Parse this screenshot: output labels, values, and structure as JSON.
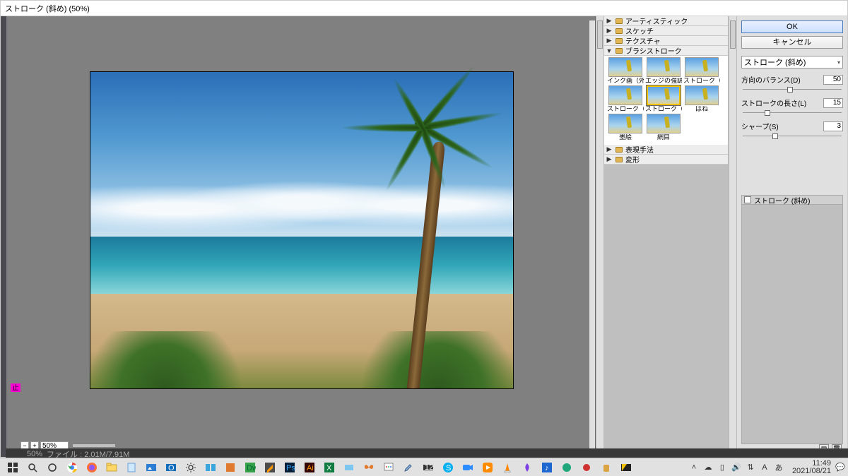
{
  "window": {
    "title": "ストローク (斜め) (50%)"
  },
  "canvas": {
    "zoom": "50%",
    "stop_indicator": "止"
  },
  "status": {
    "text": "ファイル : 2.01M/7.91M"
  },
  "filter_gallery": {
    "categories": {
      "artistic": "アーティスティック",
      "sketch": "スケッチ",
      "texture": "テクスチャ",
      "brush_strokes": "ブラシストローク",
      "stylize": "表現手法",
      "distort": "変形"
    },
    "brush_thumbs": [
      {
        "label": "インク画（外形）"
      },
      {
        "label": "エッジの強調"
      },
      {
        "label": "ストローク（スプレー）"
      },
      {
        "label": "ストローク（暗）"
      },
      {
        "label": "ストローク（斜め）"
      },
      {
        "label": "はね"
      },
      {
        "label": "墨絵"
      },
      {
        "label": "網目"
      }
    ],
    "selected_index": 4
  },
  "settings": {
    "ok": "OK",
    "cancel": "キャンセル",
    "filter_name": "ストローク (斜め)",
    "params": {
      "balance": {
        "label": "方向のバランス(D)",
        "value": "50",
        "pos": 45
      },
      "length": {
        "label": "ストロークの長さ(L)",
        "value": "15",
        "pos": 22
      },
      "sharp": {
        "label": "シャープ(S)",
        "value": "3",
        "pos": 30
      }
    }
  },
  "layers": {
    "applied": "ストローク (斜め)"
  },
  "taskbar": {
    "time": "11:49",
    "date": "2021/08/21"
  }
}
